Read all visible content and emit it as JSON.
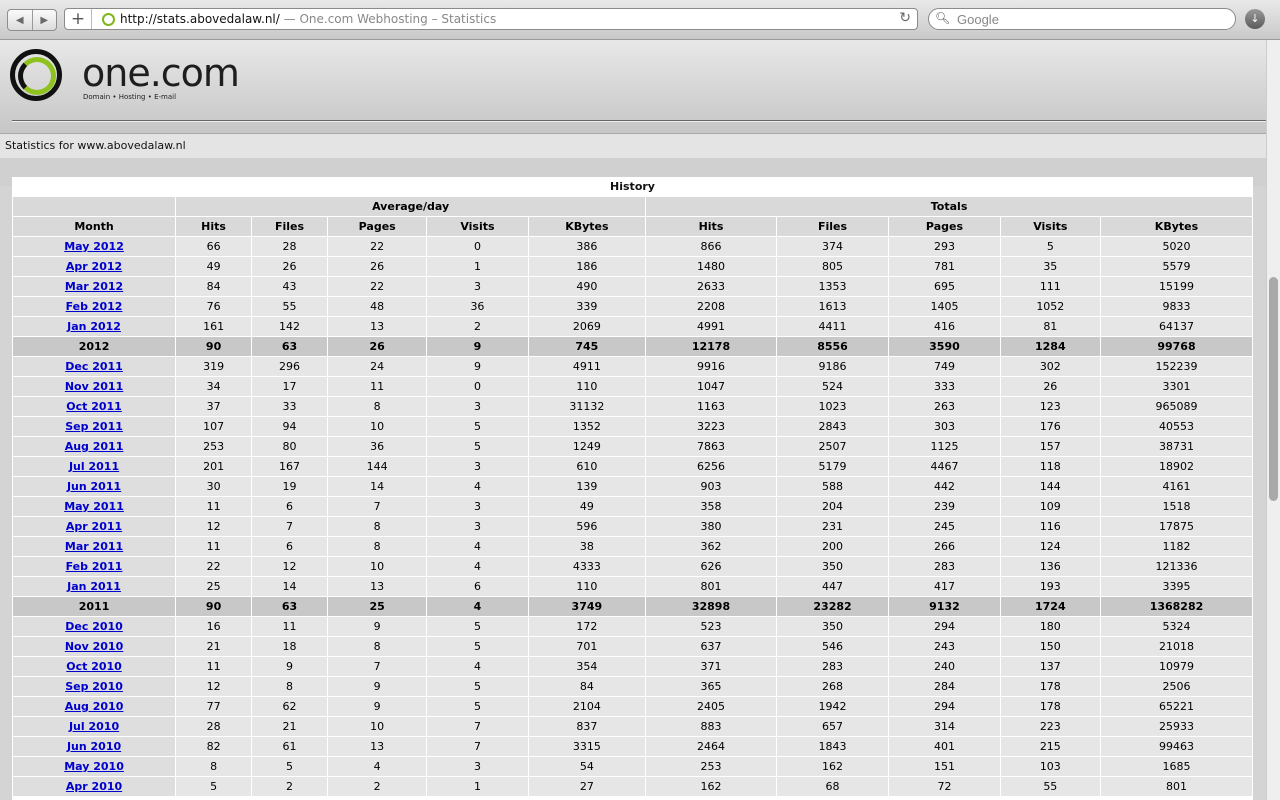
{
  "browser": {
    "url": "http://stats.abovedalaw.nl/",
    "page_title": " — One.com Webhosting – Statistics",
    "search_placeholder": "Google"
  },
  "header": {
    "logo_text": "one.com",
    "logo_tagline": "Domain • Hosting • E-mail",
    "stats_for": "Statistics for www.abovedalaw.nl"
  },
  "history": {
    "title": "History",
    "group_avg": "Average/day",
    "group_totals": "Totals",
    "columns": [
      "Month",
      "Hits",
      "Files",
      "Pages",
      "Visits",
      "KBytes",
      "Hits",
      "Files",
      "Pages",
      "Visits",
      "KBytes"
    ],
    "rows": [
      {
        "m": "May 2012",
        "v": [
          "66",
          "28",
          "22",
          "0",
          "386",
          "866",
          "374",
          "293",
          "5",
          "5020"
        ]
      },
      {
        "m": "Apr 2012",
        "v": [
          "49",
          "26",
          "26",
          "1",
          "186",
          "1480",
          "805",
          "781",
          "35",
          "5579"
        ]
      },
      {
        "m": "Mar 2012",
        "v": [
          "84",
          "43",
          "22",
          "3",
          "490",
          "2633",
          "1353",
          "695",
          "111",
          "15199"
        ]
      },
      {
        "m": "Feb 2012",
        "v": [
          "76",
          "55",
          "48",
          "36",
          "339",
          "2208",
          "1613",
          "1405",
          "1052",
          "9833"
        ]
      },
      {
        "m": "Jan 2012",
        "v": [
          "161",
          "142",
          "13",
          "2",
          "2069",
          "4991",
          "4411",
          "416",
          "81",
          "64137"
        ]
      },
      {
        "m": "2012",
        "year": true,
        "v": [
          "90",
          "63",
          "26",
          "9",
          "745",
          "12178",
          "8556",
          "3590",
          "1284",
          "99768"
        ]
      },
      {
        "m": "Dec 2011",
        "v": [
          "319",
          "296",
          "24",
          "9",
          "4911",
          "9916",
          "9186",
          "749",
          "302",
          "152239"
        ]
      },
      {
        "m": "Nov 2011",
        "v": [
          "34",
          "17",
          "11",
          "0",
          "110",
          "1047",
          "524",
          "333",
          "26",
          "3301"
        ]
      },
      {
        "m": "Oct 2011",
        "v": [
          "37",
          "33",
          "8",
          "3",
          "31132",
          "1163",
          "1023",
          "263",
          "123",
          "965089"
        ]
      },
      {
        "m": "Sep 2011",
        "v": [
          "107",
          "94",
          "10",
          "5",
          "1352",
          "3223",
          "2843",
          "303",
          "176",
          "40553"
        ]
      },
      {
        "m": "Aug 2011",
        "v": [
          "253",
          "80",
          "36",
          "5",
          "1249",
          "7863",
          "2507",
          "1125",
          "157",
          "38731"
        ]
      },
      {
        "m": "Jul 2011",
        "v": [
          "201",
          "167",
          "144",
          "3",
          "610",
          "6256",
          "5179",
          "4467",
          "118",
          "18902"
        ]
      },
      {
        "m": "Jun 2011",
        "v": [
          "30",
          "19",
          "14",
          "4",
          "139",
          "903",
          "588",
          "442",
          "144",
          "4161"
        ]
      },
      {
        "m": "May 2011",
        "v": [
          "11",
          "6",
          "7",
          "3",
          "49",
          "358",
          "204",
          "239",
          "109",
          "1518"
        ]
      },
      {
        "m": "Apr 2011",
        "v": [
          "12",
          "7",
          "8",
          "3",
          "596",
          "380",
          "231",
          "245",
          "116",
          "17875"
        ]
      },
      {
        "m": "Mar 2011",
        "v": [
          "11",
          "6",
          "8",
          "4",
          "38",
          "362",
          "200",
          "266",
          "124",
          "1182"
        ]
      },
      {
        "m": "Feb 2011",
        "v": [
          "22",
          "12",
          "10",
          "4",
          "4333",
          "626",
          "350",
          "283",
          "136",
          "121336"
        ]
      },
      {
        "m": "Jan 2011",
        "v": [
          "25",
          "14",
          "13",
          "6",
          "110",
          "801",
          "447",
          "417",
          "193",
          "3395"
        ]
      },
      {
        "m": "2011",
        "year": true,
        "v": [
          "90",
          "63",
          "25",
          "4",
          "3749",
          "32898",
          "23282",
          "9132",
          "1724",
          "1368282"
        ]
      },
      {
        "m": "Dec 2010",
        "v": [
          "16",
          "11",
          "9",
          "5",
          "172",
          "523",
          "350",
          "294",
          "180",
          "5324"
        ]
      },
      {
        "m": "Nov 2010",
        "v": [
          "21",
          "18",
          "8",
          "5",
          "701",
          "637",
          "546",
          "243",
          "150",
          "21018"
        ]
      },
      {
        "m": "Oct 2010",
        "v": [
          "11",
          "9",
          "7",
          "4",
          "354",
          "371",
          "283",
          "240",
          "137",
          "10979"
        ]
      },
      {
        "m": "Sep 2010",
        "v": [
          "12",
          "8",
          "9",
          "5",
          "84",
          "365",
          "268",
          "284",
          "178",
          "2506"
        ]
      },
      {
        "m": "Aug 2010",
        "v": [
          "77",
          "62",
          "9",
          "5",
          "2104",
          "2405",
          "1942",
          "294",
          "178",
          "65221"
        ]
      },
      {
        "m": "Jul 2010",
        "v": [
          "28",
          "21",
          "10",
          "7",
          "837",
          "883",
          "657",
          "314",
          "223",
          "25933"
        ]
      },
      {
        "m": "Jun 2010",
        "v": [
          "82",
          "61",
          "13",
          "7",
          "3315",
          "2464",
          "1843",
          "401",
          "215",
          "99463"
        ]
      },
      {
        "m": "May 2010",
        "v": [
          "8",
          "5",
          "4",
          "3",
          "54",
          "253",
          "162",
          "151",
          "103",
          "1685"
        ]
      },
      {
        "m": "Apr 2010",
        "v": [
          "5",
          "2",
          "2",
          "1",
          "27",
          "162",
          "68",
          "72",
          "55",
          "801"
        ]
      }
    ]
  }
}
